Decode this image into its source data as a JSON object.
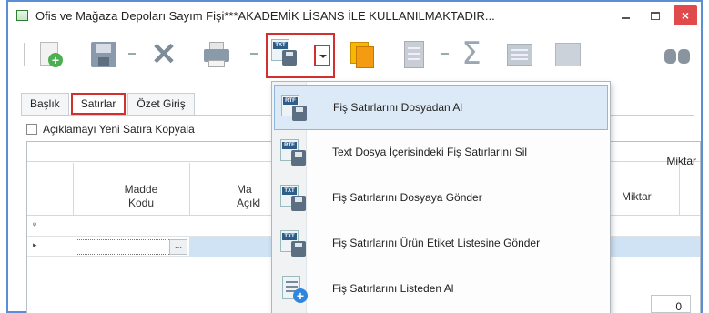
{
  "window": {
    "title": "Ofis ve Mağaza Depoları Sayım Fişi***AKADEMİK LİSANS İLE KULLANILMAKTADIR...",
    "close_glyph": "×"
  },
  "toolbar": {
    "buttons": [
      "new-icon",
      "save-icon",
      "delete-icon",
      "print-icon",
      "import-export-icon",
      "dropdown-arrow",
      "copy-icon",
      "document-icon",
      "sum-icon",
      "grid-icon",
      "table-icon",
      "binoculars-icon"
    ],
    "import_tag": "TXT",
    "sum_glyph": "Σ",
    "delete_glyph": "✕"
  },
  "tabs": [
    {
      "label": "Başlık"
    },
    {
      "label": "Satırlar",
      "active": true
    },
    {
      "label": "Özet Giriş"
    }
  ],
  "checkbox": {
    "label": "Açıklamayı Yeni Satıra Kopyala",
    "checked": false
  },
  "grid": {
    "top_header": "Miktar",
    "columns": {
      "madde_line1": "Madde",
      "madde_line2": "Kodu",
      "ma_line1": "Ma",
      "ma_line2": "Açıkl",
      "miktar": "Miktar"
    },
    "row_marker_new": "ᵠ",
    "row_marker_current": "▸",
    "ellipsis": "...",
    "footer_value": "0"
  },
  "menu": {
    "items": [
      {
        "label": "Fiş Satırlarını Dosyadan Al",
        "tag": "RTF",
        "highlighted": true
      },
      {
        "label": "Text Dosya İçerisindeki Fiş Satırlarını Sil",
        "tag": "RTF"
      },
      {
        "label": "Fiş Satırlarını Dosyaya Gönder",
        "tag": "TXT"
      },
      {
        "label": "Fiş Satırlarını Ürün Etiket Listesine Gönder",
        "tag": "TXT"
      },
      {
        "label": "Fiş Satırlarını Listeden Al",
        "icon": "list-add-icon"
      }
    ]
  },
  "colors": {
    "highlight_red": "#d32f2f",
    "menu_hover": "#dce9f6",
    "close_button": "#e04a4a",
    "window_border": "#5b8fd4"
  }
}
